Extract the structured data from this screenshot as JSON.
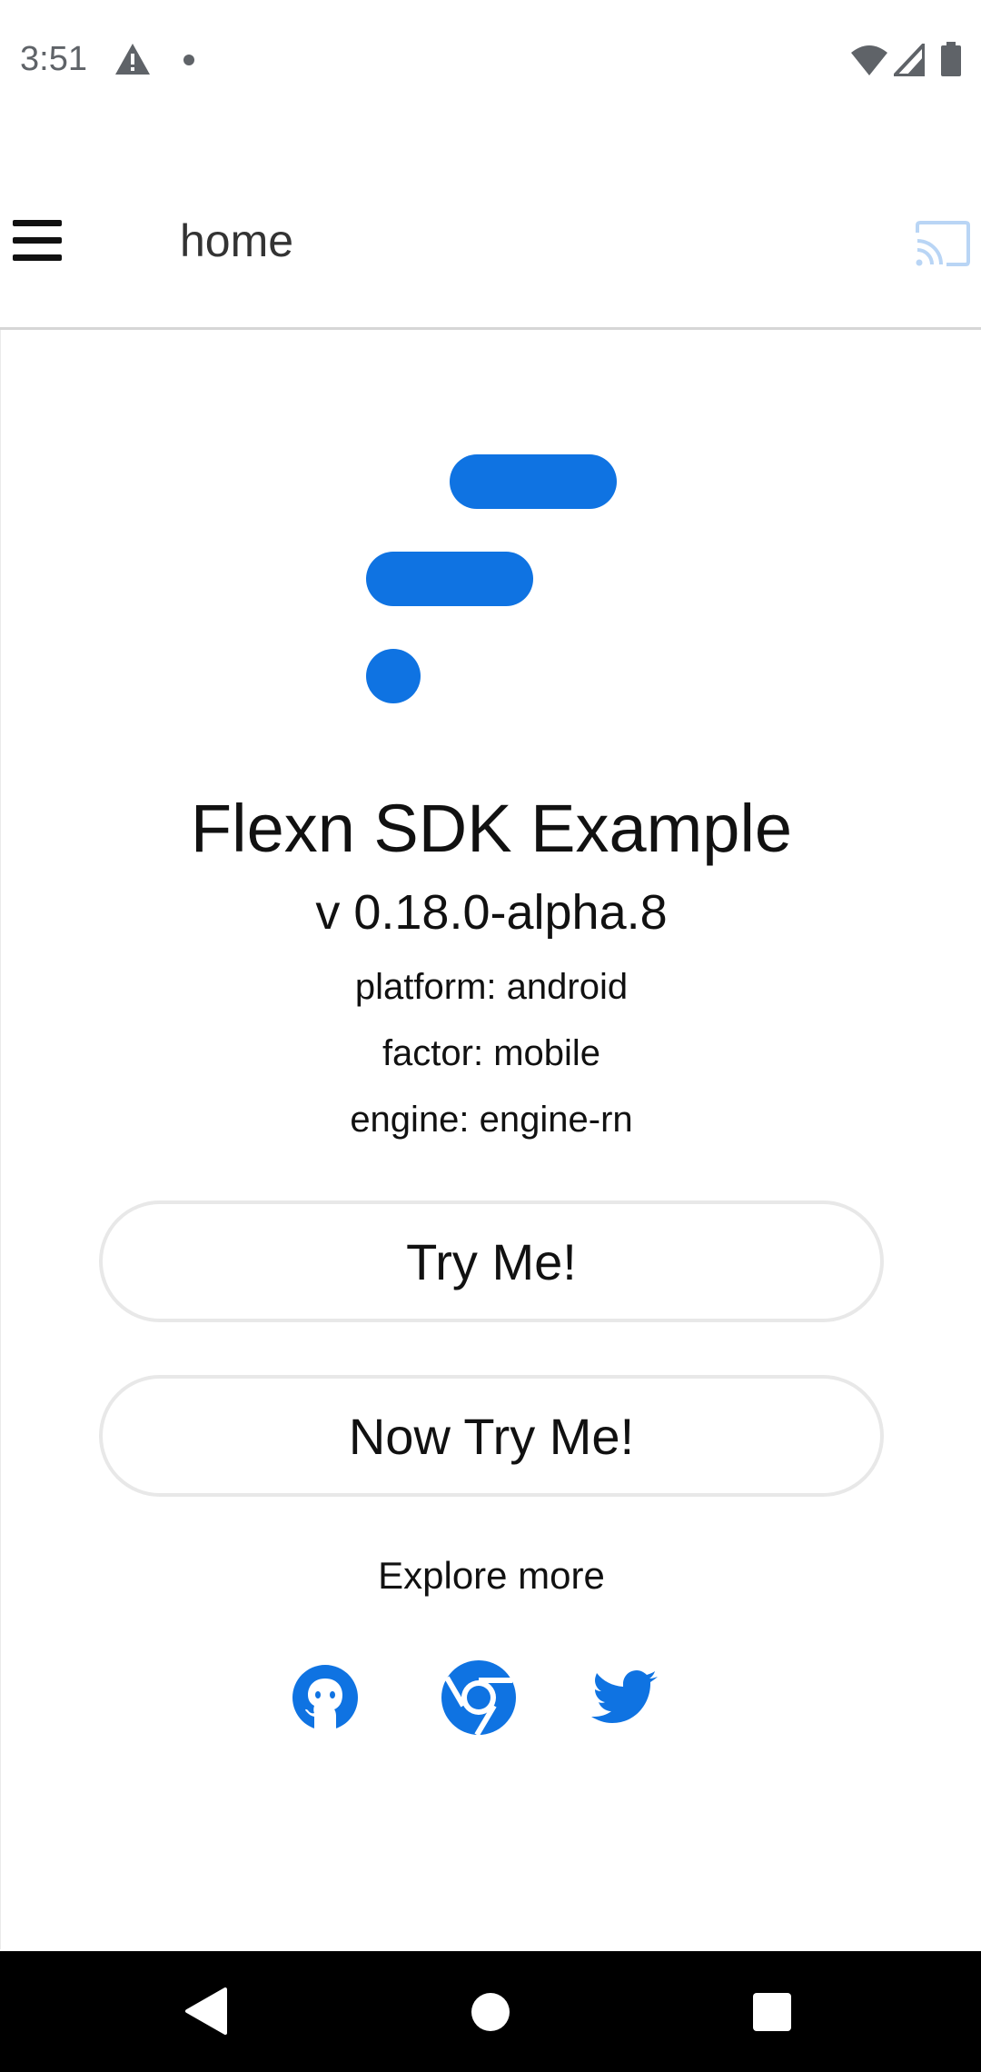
{
  "status_bar": {
    "time": "3:51",
    "icons": [
      "warning-icon",
      "notification-dot-icon",
      "wifi-icon",
      "signal-icon",
      "battery-icon"
    ]
  },
  "app_bar": {
    "title": "home",
    "menu_icon": "hamburger-menu-icon",
    "cast_icon": "cast-icon"
  },
  "main": {
    "logo_icon": "flexn-logo-icon",
    "headline": "Flexn SDK Example",
    "version": "v 0.18.0-alpha.8",
    "platform": "platform: android",
    "factor": "factor: mobile",
    "engine": "engine: engine-rn",
    "buttons": [
      {
        "label": "Try Me!"
      },
      {
        "label": "Now Try Me!"
      }
    ],
    "explore_label": "Explore more",
    "social_links": [
      {
        "icon": "github-icon"
      },
      {
        "icon": "chrome-icon"
      },
      {
        "icon": "twitter-icon"
      }
    ]
  },
  "nav_bar": {
    "icons": [
      "back-icon",
      "home-icon",
      "recents-icon"
    ]
  },
  "colors": {
    "accent": "#0f73e2",
    "cast_icon": "#b9d5f5",
    "button_border": "#e8e8e8",
    "divider": "#d6d6d6",
    "nav_bar": "#000000"
  }
}
